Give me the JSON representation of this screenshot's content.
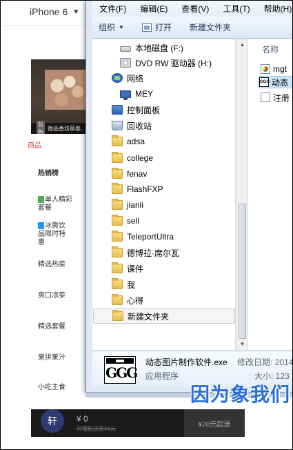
{
  "device_bar": {
    "device": "iPhone 6"
  },
  "phone": {
    "banner": {
      "ad_tag": "公告",
      "ad_text": "微品香坊莫泰…"
    },
    "menu": [
      {
        "label": "商品",
        "active": true
      },
      {
        "label": "热销榜"
      },
      {
        "label": "单人精彩套餐"
      },
      {
        "label": "冰爽饮品限时特惠"
      },
      {
        "label": "精选热菜"
      },
      {
        "label": "爽口凉菜"
      },
      {
        "label": "精选套餐"
      },
      {
        "label": "果拼果汁"
      },
      {
        "label": "小吃主食"
      }
    ],
    "cart": {
      "avatar": "轩",
      "total": "¥ 0",
      "note": "另需配送费¥4元",
      "submit": "¥20元起送"
    }
  },
  "explorer": {
    "menubar": [
      "文件(F)",
      "编辑(E)",
      "查看(V)",
      "工具(T)",
      "帮助(H)"
    ],
    "toolbar": {
      "organize": "组织",
      "open": "打开",
      "new_folder": "新建文件夹"
    },
    "nav_items": [
      {
        "label": "本地磁盘 (F:)",
        "icon": "drive-icon"
      },
      {
        "label": "DVD RW 驱动器 (H:)",
        "icon": "dvd-icon"
      },
      {
        "label": "网络",
        "icon": "network-icon"
      },
      {
        "label": "MEY",
        "icon": "computer-icon"
      },
      {
        "label": "控制面板",
        "icon": "control-panel-icon"
      },
      {
        "label": "回收站",
        "icon": "recycle-bin-icon"
      },
      {
        "label": "adsa",
        "icon": "folder-icon"
      },
      {
        "label": "college",
        "icon": "folder-icon"
      },
      {
        "label": "fenav",
        "icon": "folder-icon"
      },
      {
        "label": "FlashFXP",
        "icon": "folder-icon"
      },
      {
        "label": "jianli",
        "icon": "folder-icon"
      },
      {
        "label": "sell",
        "icon": "folder-icon"
      },
      {
        "label": "TeleportUltra",
        "icon": "folder-icon"
      },
      {
        "label": "德博拉·席尔瓦",
        "icon": "folder-icon"
      },
      {
        "label": "课件",
        "icon": "folder-icon"
      },
      {
        "label": "我",
        "icon": "folder-icon"
      },
      {
        "label": "心得",
        "icon": "folder-icon"
      },
      {
        "label": "新建文件夹",
        "icon": "folder-icon",
        "selected": true
      }
    ],
    "content": {
      "column_header": "名称",
      "files": [
        {
          "name": "mgt",
          "icon": "chrome-file-icon"
        },
        {
          "name": "动态",
          "icon": "ggg-file-icon",
          "selected": true
        },
        {
          "name": "注册",
          "icon": "document-file-icon"
        }
      ]
    },
    "details": {
      "name": "动态图片制作软件.exe",
      "type": "应用程序",
      "modified_label": "修改日期: 2014",
      "size_label": "大小: 123"
    }
  },
  "watermark": "因为象我们"
}
